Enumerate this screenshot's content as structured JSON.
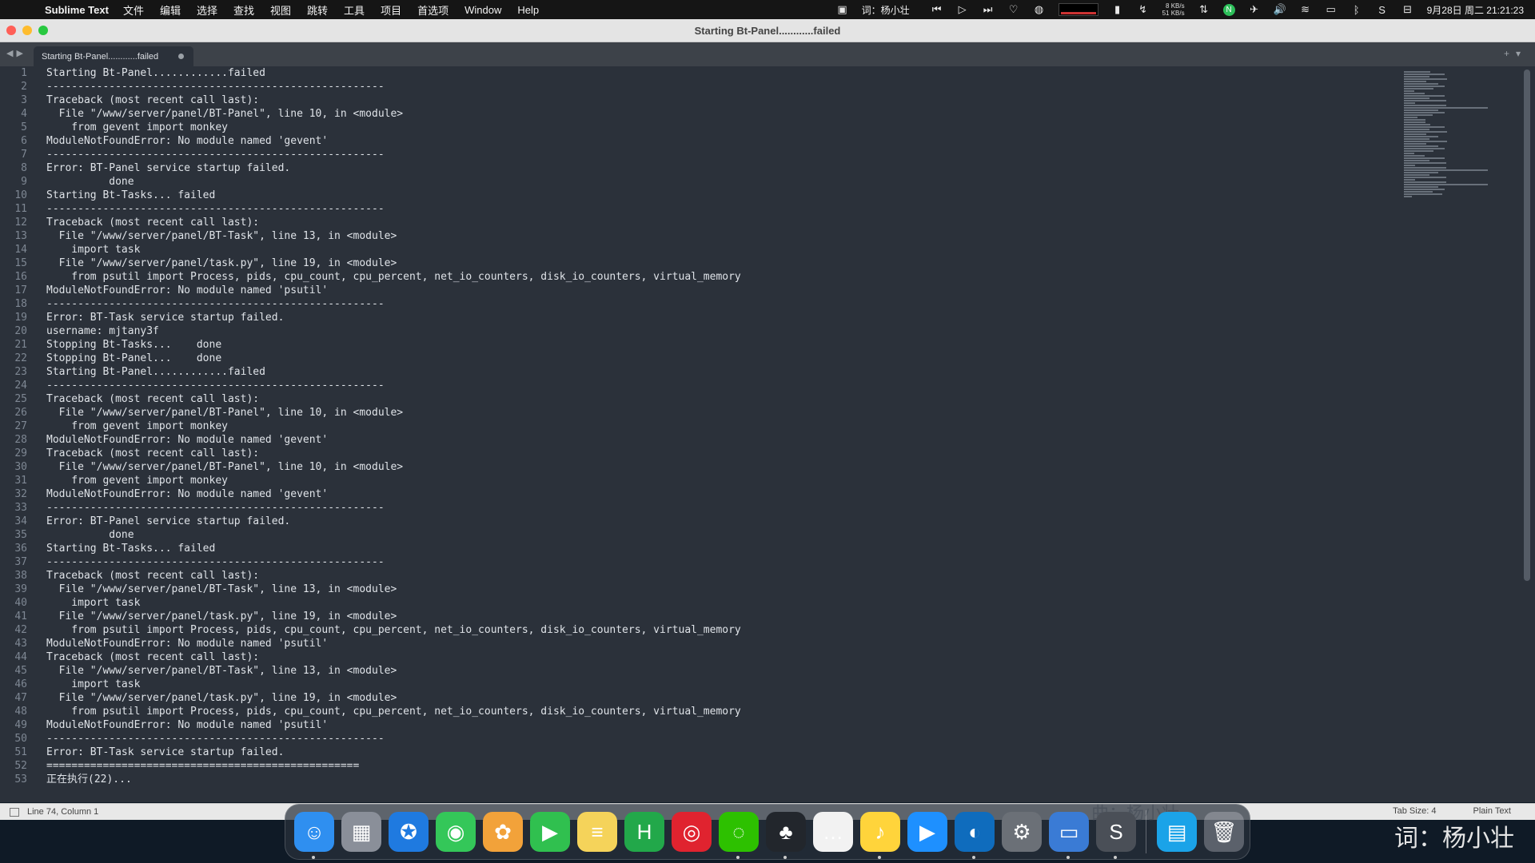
{
  "menubar": {
    "app_name": "Sublime Text",
    "items": [
      "文件",
      "编辑",
      "选择",
      "查找",
      "视图",
      "跳转",
      "工具",
      "项目",
      "首选项",
      "Window",
      "Help"
    ],
    "lyric": "词：杨小壮",
    "net_up": "8 KB/s",
    "net_down": "51 KB/s",
    "datetime": "9月28日 周二  21:21:23"
  },
  "window": {
    "title": "Starting Bt-Panel............failed",
    "tab_label": "Starting Bt-Panel............failed"
  },
  "editor": {
    "lines": [
      "Starting Bt-Panel............failed",
      "------------------------------------------------------",
      "Traceback (most recent call last):",
      "  File \"/www/server/panel/BT-Panel\", line 10, in <module>",
      "    from gevent import monkey",
      "ModuleNotFoundError: No module named 'gevent'",
      "------------------------------------------------------",
      "Error: BT-Panel service startup failed.",
      "          done",
      "Starting Bt-Tasks... failed",
      "------------------------------------------------------",
      "Traceback (most recent call last):",
      "  File \"/www/server/panel/BT-Task\", line 13, in <module>",
      "    import task",
      "  File \"/www/server/panel/task.py\", line 19, in <module>",
      "    from psutil import Process, pids, cpu_count, cpu_percent, net_io_counters, disk_io_counters, virtual_memory",
      "ModuleNotFoundError: No module named 'psutil'",
      "------------------------------------------------------",
      "Error: BT-Task service startup failed.",
      "username: mjtany3f",
      "Stopping Bt-Tasks...    done",
      "Stopping Bt-Panel...    done",
      "Starting Bt-Panel............failed",
      "------------------------------------------------------",
      "Traceback (most recent call last):",
      "  File \"/www/server/panel/BT-Panel\", line 10, in <module>",
      "    from gevent import monkey",
      "ModuleNotFoundError: No module named 'gevent'",
      "Traceback (most recent call last):",
      "  File \"/www/server/panel/BT-Panel\", line 10, in <module>",
      "    from gevent import monkey",
      "ModuleNotFoundError: No module named 'gevent'",
      "------------------------------------------------------",
      "Error: BT-Panel service startup failed.",
      "          done",
      "Starting Bt-Tasks... failed",
      "------------------------------------------------------",
      "Traceback (most recent call last):",
      "  File \"/www/server/panel/BT-Task\", line 13, in <module>",
      "    import task",
      "  File \"/www/server/panel/task.py\", line 19, in <module>",
      "    from psutil import Process, pids, cpu_count, cpu_percent, net_io_counters, disk_io_counters, virtual_memory",
      "ModuleNotFoundError: No module named 'psutil'",
      "Traceback (most recent call last):",
      "  File \"/www/server/panel/BT-Task\", line 13, in <module>",
      "    import task",
      "  File \"/www/server/panel/task.py\", line 19, in <module>",
      "    from psutil import Process, pids, cpu_count, cpu_percent, net_io_counters, disk_io_counters, virtual_memory",
      "ModuleNotFoundError: No module named 'psutil'",
      "------------------------------------------------------",
      "Error: BT-Task service startup failed.",
      "==================================================",
      "正在执行(22)..."
    ]
  },
  "statusbar": {
    "position": "Line 74, Column 1",
    "tab_size": "Tab Size: 4",
    "syntax": "Plain Text",
    "watermark": "曲：杨小壮"
  },
  "dock": {
    "apps": [
      {
        "name": "finder-icon",
        "glyph": "☺",
        "bg": "#2f8ff0",
        "running": true
      },
      {
        "name": "launchpad-icon",
        "glyph": "▦",
        "bg": "#8a8f99",
        "running": false
      },
      {
        "name": "safari-icon",
        "glyph": "✪",
        "bg": "#1f7ae0",
        "running": false
      },
      {
        "name": "messages-icon",
        "glyph": "◉",
        "bg": "#34c759",
        "running": false
      },
      {
        "name": "photos-icon",
        "glyph": "✿",
        "bg": "#f2a23a",
        "running": false
      },
      {
        "name": "facetime-icon",
        "glyph": "▶",
        "bg": "#30c04f",
        "running": false
      },
      {
        "name": "notes-icon",
        "glyph": "≡",
        "bg": "#f5d35a",
        "running": false
      },
      {
        "name": "hbuilder-icon",
        "glyph": "H",
        "bg": "#22a84a",
        "running": false
      },
      {
        "name": "netease-music-icon",
        "glyph": "◎",
        "bg": "#e0232f",
        "running": false
      },
      {
        "name": "wechat-icon",
        "glyph": "◌",
        "bg": "#2dc100",
        "running": true
      },
      {
        "name": "qq-icon",
        "glyph": "♣",
        "bg": "#22262c",
        "running": true
      },
      {
        "name": "chat-bubble-icon",
        "glyph": "…",
        "bg": "#f2f2f2",
        "running": false
      },
      {
        "name": "qq-music-icon",
        "glyph": "♪",
        "bg": "#ffd43b",
        "running": true
      },
      {
        "name": "infuse-player-icon",
        "glyph": "▶",
        "bg": "#1e90ff",
        "running": false
      },
      {
        "name": "edge-icon",
        "glyph": "◐",
        "bg": "#0f6cbd",
        "running": true
      },
      {
        "name": "system-preferences-icon",
        "glyph": "⚙",
        "bg": "#6b7077",
        "running": false
      },
      {
        "name": "remote-desktop-icon",
        "glyph": "▭",
        "bg": "#3a7bd5",
        "running": true
      },
      {
        "name": "sublime-text-icon",
        "glyph": "S",
        "bg": "#4a4f57",
        "running": true
      },
      {
        "name": "downloads-folder-icon",
        "glyph": "▤",
        "bg": "#1ba3e8",
        "running": false
      },
      {
        "name": "trash-icon",
        "glyph": "🗑",
        "bg": "rgba(200,200,210,0.35)",
        "running": false
      }
    ]
  },
  "desktop": {
    "lyric": "词：杨小壮"
  }
}
